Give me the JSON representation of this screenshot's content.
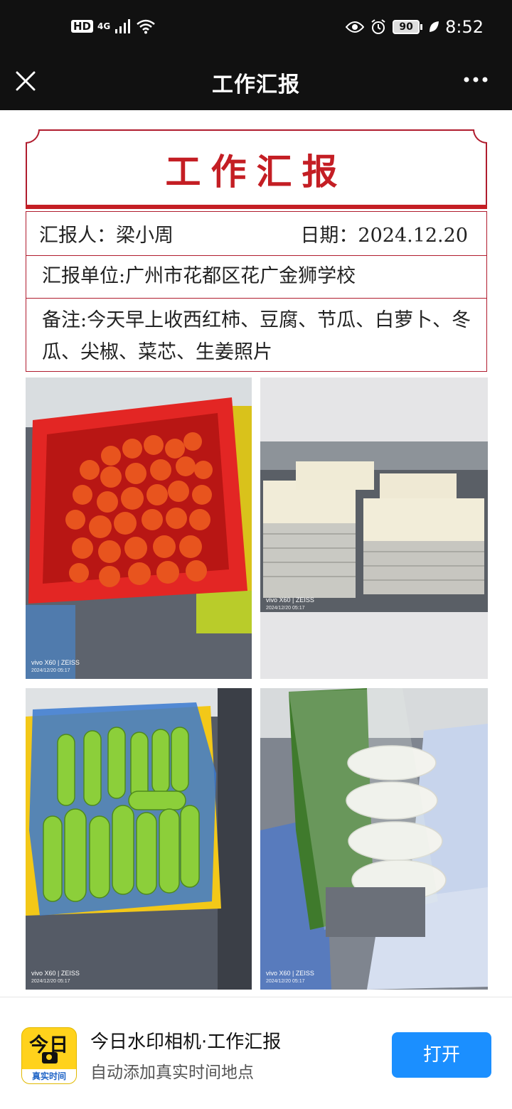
{
  "status_bar": {
    "hd": "HD",
    "network": "4G",
    "battery": "90",
    "time": "8:52"
  },
  "nav": {
    "title": "工作汇报",
    "close_icon": "close-icon",
    "more_icon": "more-icon"
  },
  "report": {
    "title": "工作汇报",
    "reporter": "汇报人：梁小周",
    "date": "日期：2024.12.20",
    "unit": "汇报单位:广州市花都区花广金狮学校",
    "note": "备注:今天早上收西红柿、豆腐、节瓜、白萝卜、冬瓜、尖椒、菜芯、生姜照片",
    "accent_color": "#c41e24"
  },
  "photos": [
    {
      "watermark_brand": "vivo X60 | ZEISS",
      "watermark_time": "2024/12/20 05:17"
    },
    {
      "watermark_brand": "vivo X60 | ZEISS",
      "watermark_time": "2024/12/20 05:17"
    },
    {
      "watermark_brand": "vivo X60 | ZEISS",
      "watermark_time": "2024/12/20 05:17"
    },
    {
      "watermark_brand": "vivo X60 | ZEISS",
      "watermark_time": "2024/12/20 05:17"
    }
  ],
  "banner": {
    "icon_text": "今日",
    "icon_tag": "真实时间",
    "title": "今日水印相机·工作汇报",
    "subtitle": "自动添加真实时间地点",
    "open_label": "打开",
    "button_color": "#1b8fff"
  }
}
